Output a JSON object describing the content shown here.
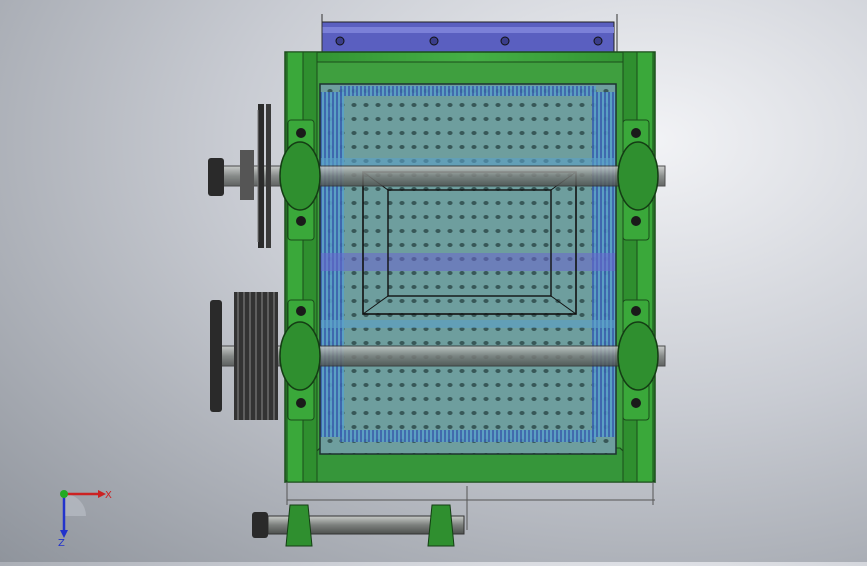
{
  "viewport": {
    "background_top": "#eef0f4",
    "background_bottom": "#8f949c"
  },
  "model": {
    "frame_color": "#3aa33a",
    "frame_dark": "#1e6e1e",
    "hopper_color": "#4a4fb0",
    "screen_color": "#62a7a8",
    "shaft_color": "#8a8f8c",
    "pulley_color": "#2f2f2f"
  },
  "triad": {
    "x_label": "X",
    "z_label": "Z",
    "x_color": "#cc2222",
    "y_color": "#22aa22",
    "z_color": "#2233cc"
  }
}
